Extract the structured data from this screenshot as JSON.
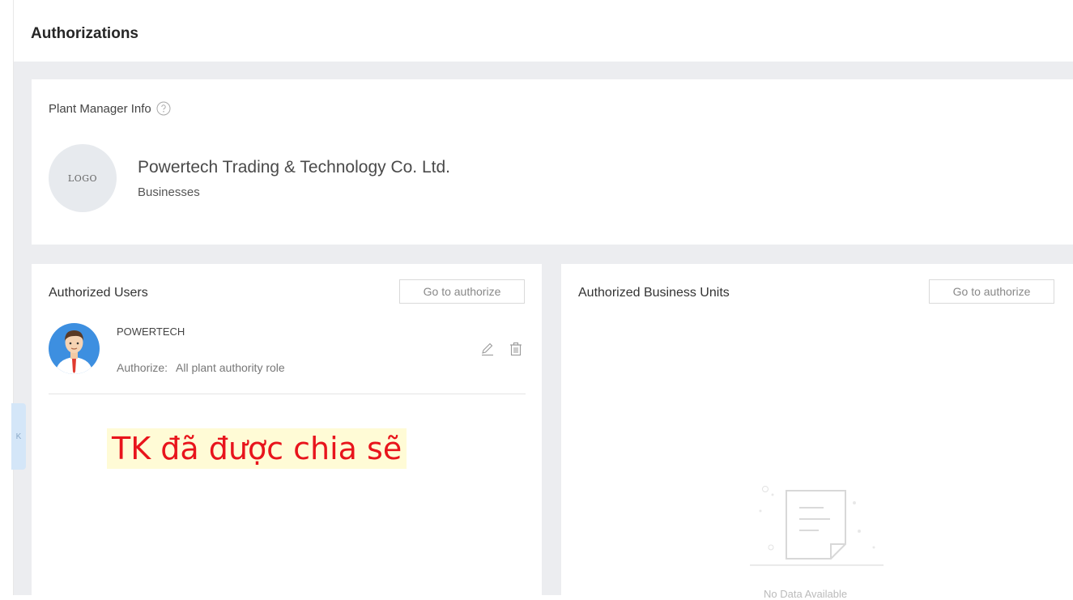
{
  "page": {
    "title": "Authorizations"
  },
  "plant_info": {
    "title": "Plant Manager Info",
    "logo_text": "LOGO",
    "company_name": "Powertech Trading & Technology Co. Ltd.",
    "company_type": "Businesses"
  },
  "authorized_users": {
    "title": "Authorized Users",
    "button_label": "Go to authorize",
    "users": [
      {
        "name": "POWERTECH",
        "authorize_label": "Authorize:",
        "authorize_value": "All plant authority role"
      }
    ],
    "annotation": "TK đã được chia sẽ"
  },
  "authorized_units": {
    "title": "Authorized Business Units",
    "button_label": "Go to authorize",
    "empty_text": "No Data Available"
  },
  "sidebar": {
    "collapse_glyph": "K"
  },
  "colors": {
    "background": "#ecedf0",
    "card": "#ffffff",
    "annotation_text": "#e8141c",
    "annotation_bg": "#fffbd6",
    "collapse_tab": "#d4e6f8"
  },
  "icons": {
    "help": "help-circle-icon",
    "edit": "pencil-icon",
    "delete": "trash-icon",
    "avatar": "user-avatar-icon",
    "empty": "empty-document-icon"
  }
}
